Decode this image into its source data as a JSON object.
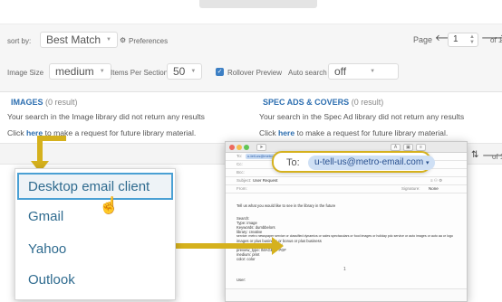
{
  "toolbar": {
    "sort_label": "sort by:",
    "sort_value": "Best Match",
    "preferences_label": "Preferences",
    "page_label": "Page",
    "page_value": "1",
    "page_total": "of 1",
    "image_size_label": "Image Size",
    "image_size_value": "medium",
    "items_per_section_label": "Items Per Section",
    "items_per_section_value": "50",
    "rollover_preview_label": "Rollover Preview",
    "auto_search_label": "Auto search",
    "auto_search_value": "off"
  },
  "images_section": {
    "title": "IMAGES",
    "count": "(0 result)",
    "message": "Your search in the Image library did not return any results",
    "request_prefix": "Click",
    "request_link": "here",
    "request_suffix": "to make a request for future library material."
  },
  "spec_section": {
    "title": "SPEC ADS & COVERS",
    "count": "(0 result)",
    "message": "Your search in the Spec Ad library did not return any results",
    "request_prefix": "Click",
    "request_link": "here",
    "request_suffix": "to make a request for future library material."
  },
  "secondary_pager": {
    "total": "of 1"
  },
  "email_menu": {
    "items": [
      "Desktop email client",
      "Gmail",
      "Yahoo",
      "Outlook"
    ]
  },
  "mail": {
    "to_label": "To:",
    "to_address": "u-tell-us@metro-email.com",
    "cc_label": "Cc:",
    "bcc_label": "Bcc:",
    "subject_label": "Subject:",
    "subject_value": "User Request",
    "from_label": "From:",
    "signature_label": "Signature:",
    "signature_value": "None",
    "body_intro": "Tell us what you would like to see in the library in the future",
    "body_lines": [
      "Search:",
      "Type: image",
      "Keywords: dumbbelors",
      "library: creative",
      "service: metro newspaper service or classified dynamics or sales spectaculars or food images or holiday pdc service or auto images or auto aa or logo",
      "images or plus business or bonus or plus business",
      "media_type: image or head",
      "preview_type: IMAGE or PDF",
      "medium: print",
      "color: color"
    ],
    "user_label": "User:",
    "page_number": "1"
  },
  "callout": {
    "to_label": "To:",
    "to_address": "u-tell-us@metro-email.com"
  },
  "colors": {
    "link_blue": "#2c6eb0",
    "callout_gold": "#d5b11d",
    "checkbox_blue": "#3c7fc4"
  }
}
